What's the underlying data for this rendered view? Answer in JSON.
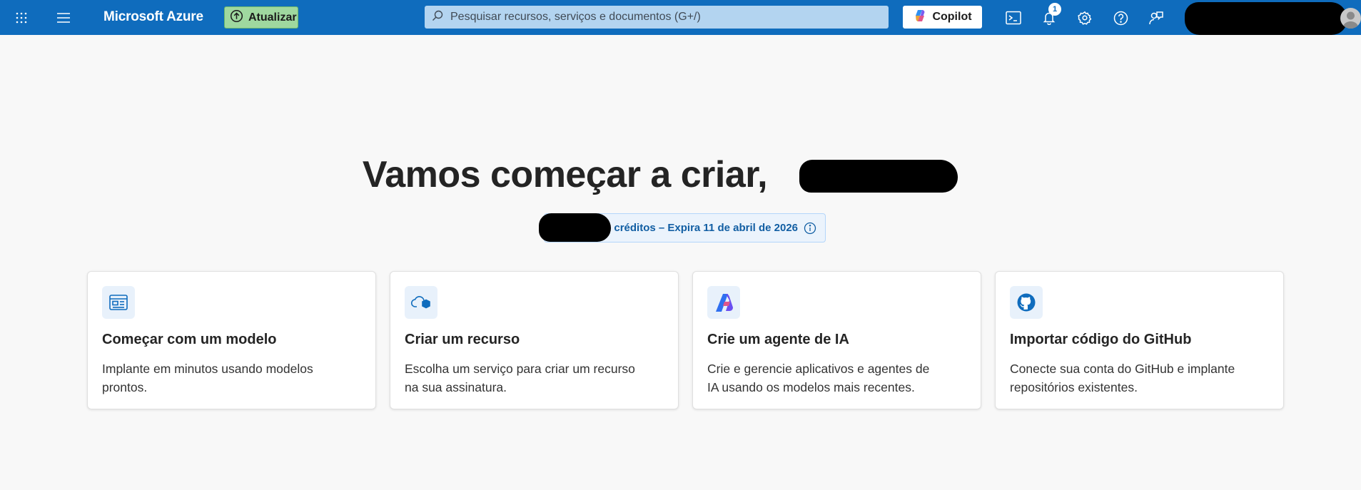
{
  "header": {
    "brand": "Microsoft Azure",
    "upgrade_label": "Atualizar",
    "search_placeholder": "Pesquisar recursos, serviços e documentos (G+/)",
    "copilot_label": "Copilot",
    "notification_count": "1",
    "icons": [
      "app-launcher-icon",
      "hamburger-icon",
      "cloud-shell-icon",
      "bell-icon",
      "gear-icon",
      "help-icon",
      "feedback-icon"
    ]
  },
  "hero": {
    "title": "Vamos começar a criar,",
    "credits_text": "em créditos – Expira 11 de abril de 2026"
  },
  "cards": [
    {
      "title": "Começar com um modelo",
      "description": "Implante em minutos usando modelos prontos.",
      "icon": "template-icon"
    },
    {
      "title": "Criar um recurso",
      "description": "Escolha um serviço para criar um recurso na sua assinatura.",
      "icon": "cloud-resource-icon"
    },
    {
      "title": "Crie um agente de IA",
      "description": "Crie e gerencie aplicativos e agentes de IA usando os modelos mais recentes.",
      "icon": "ai-foundry-icon"
    },
    {
      "title": "Importar código do GitHub",
      "description": "Conecte sua conta do GitHub e implante repositórios existentes.",
      "icon": "github-icon"
    }
  ],
  "colors": {
    "topbar": "#0f6cbd",
    "upgrade": "#9fd89f",
    "pill_bg": "#ebf3fc",
    "pill_text": "#115ea3"
  }
}
